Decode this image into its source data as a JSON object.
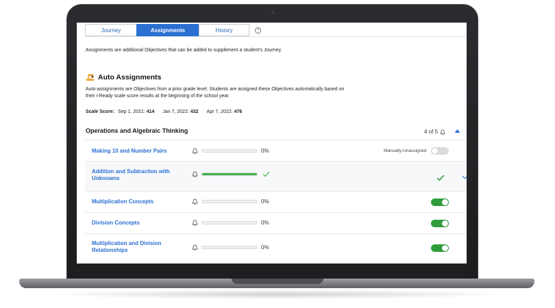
{
  "tabs": {
    "journey": "Journey",
    "assignments": "Assignments",
    "history": "History",
    "help": "?"
  },
  "intro": "Assignments are additional Objectives that can be added to supplement a student's Journey.",
  "auto": {
    "title": "Auto Assignments",
    "description": "Auto-assignments are Objectives from a prior grade level. Students are assigned these Objectives automatically based on their i-Ready scale score results at the beginning of the school year."
  },
  "scale_score": {
    "label": "Scale Score:",
    "entries": [
      {
        "date": "Sep 1, 2021:",
        "score": "414"
      },
      {
        "date": "Jan 7, 2022:",
        "score": "432"
      },
      {
        "date": "Apr 7, 2022:",
        "score": "476"
      }
    ]
  },
  "section": {
    "title": "Operations and Algebraic Thinking",
    "count": "4 of 5"
  },
  "objectives": [
    {
      "name": "Making 10 and Number Pairs",
      "progress": 0,
      "percent_label": "0%",
      "status_text": "Manually-Unassigned",
      "toggle": "off"
    },
    {
      "name": "Addition and Subtraction with Unknowns",
      "progress": 100,
      "percent_label": "",
      "status_text": "",
      "toggle": "complete"
    },
    {
      "name": "Multiplication Concepts",
      "progress": 0,
      "percent_label": "0%",
      "status_text": "",
      "toggle": "on"
    },
    {
      "name": "Division Concepts",
      "progress": 0,
      "percent_label": "0%",
      "status_text": "",
      "toggle": "on"
    },
    {
      "name": "Multiplication and Division Relationships",
      "progress": 0,
      "percent_label": "0%",
      "status_text": "",
      "toggle": "on"
    }
  ],
  "colors": {
    "accent_blue": "#2a6fd1",
    "progress_green": "#41b04a",
    "toggle_on": "#2f9d3b",
    "toggle_off": "#d9dbde"
  }
}
